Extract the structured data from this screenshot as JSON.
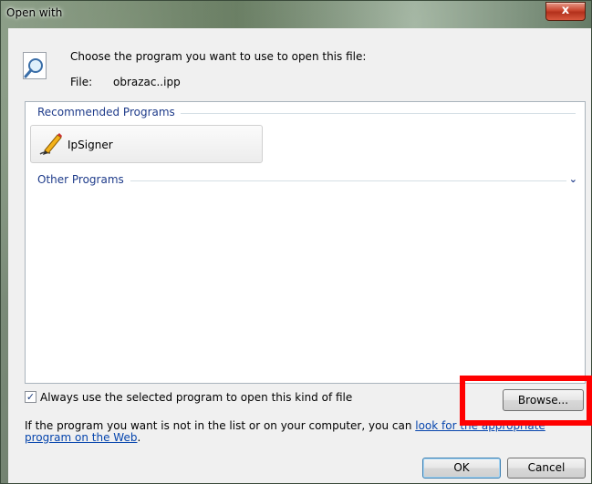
{
  "window": {
    "title": "Open with",
    "close_glyph": "x"
  },
  "header": {
    "prompt": "Choose the program you want to use to open this file:",
    "file_label": "File:",
    "file_name": "obrazac..ipp",
    "icon": "magnifier-document-icon"
  },
  "list": {
    "recommended_header": "Recommended Programs",
    "recommended": [
      {
        "label": "IpSigner",
        "icon": "pen-signer-icon"
      }
    ],
    "other_header": "Other Programs",
    "other_chevron": "⌄"
  },
  "options": {
    "always_use_label": "Always use the selected program to open this kind of file",
    "always_use_checked": true,
    "check_glyph": "✓"
  },
  "buttons": {
    "browse": "Browse...",
    "ok": "OK",
    "cancel": "Cancel"
  },
  "help": {
    "text": "If the program you want is not in the list or on your computer, you can ",
    "link": "look for the appropriate program on the Web",
    "suffix": "."
  },
  "colors": {
    "group_header": "#1e3b8a",
    "link": "#0645ad",
    "highlight": "#ff0000"
  }
}
